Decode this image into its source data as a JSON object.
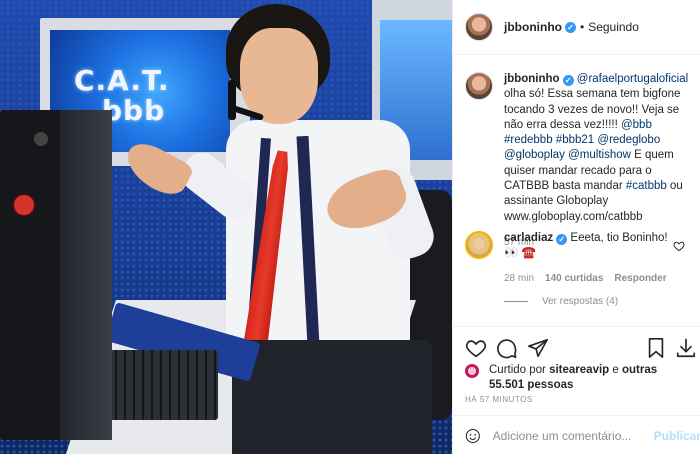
{
  "post": {
    "image_alt": "",
    "screen_text_1": "C.A.T.",
    "screen_text_2": "bbb"
  },
  "header": {
    "username": "jbboninho",
    "separator": "•",
    "follow_status": "Seguindo"
  },
  "caption": {
    "username": "jbboninho",
    "mention": "@rafaelportugaloficial",
    "text_1": "olha só! Essa semana tem bigfone tocando 3 vezes de novo!! Veja se não erra dessa vez!!!!! ",
    "tag_bbb": "@bbb",
    "tag_redebbb": "#redebbb",
    "tag_bbb21": "#bbb21",
    "tag_redeglobo": "@redeglobo",
    "tag_globoplay": "@globoplay",
    "tag_multishow": "@multishow",
    "text_2": " E quem quiser mandar recado para o CATBBB basta mandar ",
    "tag_catbbb": "#catbbb",
    "text_3": " ou assinante Globoplay www.globoplay.com/catbbb",
    "time": "57 min"
  },
  "comment": {
    "username": "carladiaz",
    "text": " Eeeta, tio Boninho! 👀 ☎️",
    "time": "28 min",
    "likes": "140 curtidas",
    "reply": "Responder",
    "view_replies": "Ver respostas (4)"
  },
  "likes": {
    "prefix": "Curtido por ",
    "user": "siteareavip",
    "middle": " e ",
    "others": "outras 55.501 pessoas"
  },
  "posted_ago": "HÁ 57 MINUTOS",
  "add_comment": {
    "placeholder": "Adicione um comentário...",
    "publish": "Publicar"
  },
  "icons": [
    "heart-icon",
    "comment-icon",
    "share-icon",
    "bookmark-icon",
    "download-icon",
    "emoji-icon"
  ]
}
